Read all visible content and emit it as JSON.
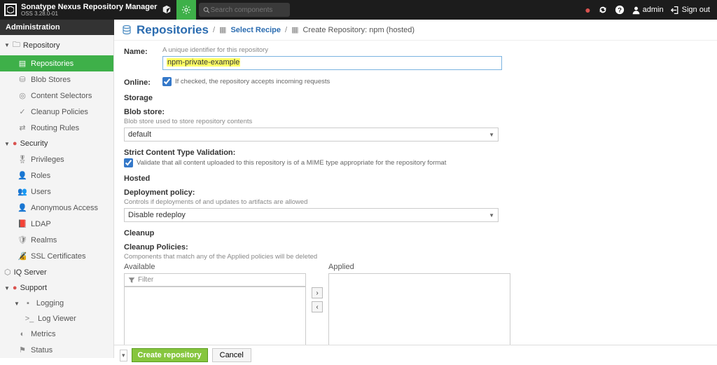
{
  "header": {
    "product": "Sonatype Nexus Repository Manager",
    "version": "OSS 3.28.0-01",
    "search_placeholder": "Search components",
    "user": "admin",
    "signout": "Sign out"
  },
  "admin_label": "Administration",
  "sidebar": {
    "groups": [
      {
        "label": "Repository",
        "items": [
          {
            "label": "Repositories",
            "icon": "stack-icon",
            "active": true
          },
          {
            "label": "Blob Stores",
            "icon": "disk-icon"
          },
          {
            "label": "Content Selectors",
            "icon": "target-icon"
          },
          {
            "label": "Cleanup Policies",
            "icon": "broom-icon"
          },
          {
            "label": "Routing Rules",
            "icon": "route-icon"
          }
        ]
      },
      {
        "label": "Security",
        "badge": true,
        "items": [
          {
            "label": "Privileges",
            "icon": "badge-icon"
          },
          {
            "label": "Roles",
            "icon": "person-icon"
          },
          {
            "label": "Users",
            "icon": "people-icon"
          },
          {
            "label": "Anonymous Access",
            "icon": "anon-icon"
          },
          {
            "label": "LDAP",
            "icon": "book-icon"
          },
          {
            "label": "Realms",
            "icon": "shield-icon"
          },
          {
            "label": "SSL Certificates",
            "icon": "cert-icon"
          }
        ]
      },
      {
        "label": "IQ Server",
        "flat": true,
        "icon": "shield2-icon"
      },
      {
        "label": "Support",
        "badge": true,
        "items": [
          {
            "label": "Logging",
            "icon": "log-icon",
            "subitems": [
              {
                "label": "Log Viewer",
                "icon": "terminal-icon"
              }
            ]
          },
          {
            "label": "Metrics",
            "icon": "gauge-icon"
          },
          {
            "label": "Status",
            "icon": "status-icon"
          }
        ]
      }
    ]
  },
  "breadcrumb": {
    "title": "Repositories",
    "select_recipe": "Select Recipe",
    "create": "Create Repository: npm (hosted)"
  },
  "form": {
    "name_label": "Name:",
    "name_hint": "A unique identifier for this repository",
    "name_value": "npm-private-example",
    "online_label": "Online:",
    "online_hint": "If checked, the repository accepts incoming requests",
    "online_checked": true,
    "storage_section": "Storage",
    "blob_label": "Blob store:",
    "blob_hint": "Blob store used to store repository contents",
    "blob_value": "default",
    "strict_label": "Strict Content Type Validation:",
    "strict_hint": "Validate that all content uploaded to this repository is of a MIME type appropriate for the repository format",
    "strict_checked": true,
    "hosted_section": "Hosted",
    "deploy_label": "Deployment policy:",
    "deploy_hint": "Controls if deployments of and updates to artifacts are allowed",
    "deploy_value": "Disable redeploy",
    "cleanup_section": "Cleanup",
    "cleanup_label": "Cleanup Policies:",
    "cleanup_hint": "Components that match any of the Applied policies will be deleted",
    "available_label": "Available",
    "applied_label": "Applied",
    "filter_placeholder": "Filter"
  },
  "footer": {
    "create": "Create repository",
    "cancel": "Cancel"
  }
}
